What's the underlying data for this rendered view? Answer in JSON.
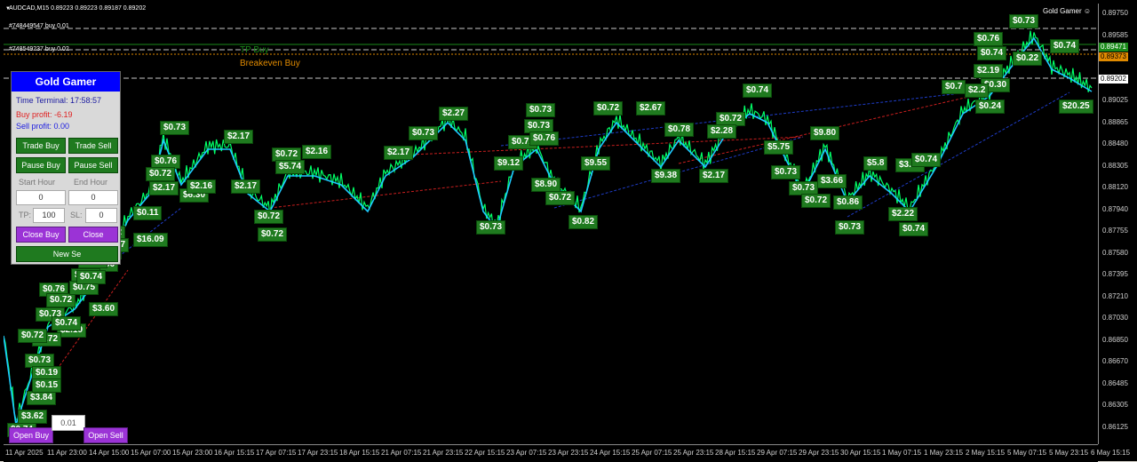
{
  "chart": {
    "title": "AUDCAD,M15  0.89223 0.89223 0.89187 0.89202",
    "ea_name": "Gold Gamer ☺",
    "orders": [
      {
        "label": "#748449547 buy 0.01"
      },
      {
        "label": "#748549237 buy 0.02"
      }
    ],
    "tp_label": "TP Buy",
    "breakeven_label": "Breakeven Buy",
    "price_ticks": [
      "0.89750",
      "0.89585",
      "0.89420",
      "0.89202",
      "0.89025",
      "0.88865",
      "0.88480",
      "0.88305",
      "0.88120",
      "0.87940",
      "0.87755",
      "0.87580",
      "0.87395",
      "0.87210",
      "0.87030",
      "0.86850",
      "0.86670",
      "0.86485",
      "0.86305",
      "0.86125"
    ],
    "price_tag_tp": "0.89471",
    "price_tag_be": "0.89373",
    "price_tag_current": "0.89202",
    "time_ticks": [
      "11 Apr 2025",
      "11 Apr 23:00",
      "14 Apr 15:00",
      "15 Apr 07:00",
      "15 Apr 23:00",
      "16 Apr 15:15",
      "17 Apr 07:15",
      "17 Apr 23:15",
      "18 Apr 15:15",
      "21 Apr 07:15",
      "21 Apr 23:15",
      "22 Apr 15:15",
      "23 Apr 07:15",
      "23 Apr 23:15",
      "24 Apr 15:15",
      "25 Apr 07:15",
      "25 Apr 23:15",
      "28 Apr 15:15",
      "29 Apr 07:15",
      "29 Apr 23:15",
      "30 Apr 15:15",
      "1 May 07:15",
      "1 May 23:15",
      "2 May 15:15",
      "5 May 07:15",
      "5 May 23:15",
      "6 May 15:15"
    ],
    "colors": {
      "bg": "#000000",
      "price": "#00ff66",
      "ma": "#1ec9ff",
      "badge": "#1f7a1f",
      "tp_line": "#1a8a1a",
      "be_line": "#e08a00",
      "order_line": "#c8c8c8"
    },
    "profit_badges": [
      {
        "text": "$0.73"
      },
      {
        "text": "$0.76"
      },
      {
        "text": "$0.74"
      },
      {
        "text": "$0.22"
      },
      {
        "text": "$0.74"
      },
      {
        "text": "$2.19"
      },
      {
        "text": "$0.30"
      },
      {
        "text": "$0.7"
      },
      {
        "text": "$2.2"
      },
      {
        "text": "$0.24"
      },
      {
        "text": "$20.25"
      },
      {
        "text": "$0.74"
      },
      {
        "text": "$0.72"
      },
      {
        "text": "$2.27"
      },
      {
        "text": "$0.73"
      },
      {
        "text": "$0.72"
      },
      {
        "text": "$2.67"
      },
      {
        "text": "$0.73"
      },
      {
        "text": "$0.72"
      },
      {
        "text": "$2.17"
      },
      {
        "text": "$0.72"
      },
      {
        "text": "$2.17"
      },
      {
        "text": "$0.73"
      },
      {
        "text": "$0.76"
      },
      {
        "text": "$0.78"
      },
      {
        "text": "$2.28"
      },
      {
        "text": "$9.80"
      },
      {
        "text": "$0.76"
      },
      {
        "text": "$5.74"
      },
      {
        "text": "$2.16"
      },
      {
        "text": "$9.12"
      },
      {
        "text": "$9.55"
      },
      {
        "text": "$5.75"
      },
      {
        "text": "$3.62"
      },
      {
        "text": "$0.74"
      },
      {
        "text": "$5.8"
      },
      {
        "text": "$0.73"
      },
      {
        "text": "$9.38"
      },
      {
        "text": "$2.17"
      },
      {
        "text": "$0.73"
      },
      {
        "text": "$3.66"
      },
      {
        "text": "$6.30"
      },
      {
        "text": "$2.16"
      },
      {
        "text": "$2.17"
      },
      {
        "text": "$8.90"
      },
      {
        "text": "$0.72"
      },
      {
        "text": "$0.72"
      },
      {
        "text": "$0.86"
      },
      {
        "text": "$2.22"
      },
      {
        "text": "$0.72"
      },
      {
        "text": "$0.72"
      },
      {
        "text": "$0.73"
      },
      {
        "text": "$0.82"
      },
      {
        "text": "$0.73"
      },
      {
        "text": "$0.74"
      },
      {
        "text": "$16.09"
      },
      {
        "text": "$0.11"
      },
      {
        "text": "$0.72"
      },
      {
        "text": "$3.86"
      },
      {
        "text": "$3.60"
      },
      {
        "text": "$2.19"
      },
      {
        "text": "$0.72"
      },
      {
        "text": "$3.84"
      },
      {
        "text": "$3.62"
      },
      {
        "text": "$0.74"
      },
      {
        "text": "$0.73"
      },
      {
        "text": "$0.76"
      },
      {
        "text": "$0.72"
      },
      {
        "text": "$2.17"
      },
      {
        "text": "$0.74"
      },
      {
        "text": "$0.72"
      },
      {
        "text": "$0.73"
      },
      {
        "text": "$2.17"
      },
      {
        "text": "$0.76"
      },
      {
        "text": "$0.72"
      },
      {
        "text": "$0.73"
      },
      {
        "text": "$0.74"
      },
      {
        "text": "$0.72"
      },
      {
        "text": "$0.73"
      },
      {
        "text": "$0.75"
      },
      {
        "text": "$0.74"
      },
      {
        "text": "$0.19"
      },
      {
        "text": "$0.15"
      }
    ]
  },
  "panel": {
    "title": "Gold Gamer",
    "time_label": "Time Terminal: 17:58:57",
    "buy_profit": "Buy profit: -6.19",
    "sell_profit": "Sell profit: 0.00",
    "buttons": {
      "trade_buy": "Trade Buy",
      "trade_sell": "Trade Sell",
      "pause_buy": "Pause Buy",
      "pause_sell": "Pause Sell",
      "close_buy": "Close Buy",
      "close_sell": "Close",
      "new_session": "New Se"
    },
    "start_hour_label": "Start Hour",
    "end_hour_label": "End Hour",
    "start_hour_value": "0",
    "end_hour_value": "0",
    "tp_label": "TP:",
    "tp_value": "100",
    "sl_label": "SL:",
    "sl_value": "0"
  },
  "bottom": {
    "open_buy": "Open Buy",
    "open_sell": "Open Sell",
    "lot_value": "0.01"
  }
}
